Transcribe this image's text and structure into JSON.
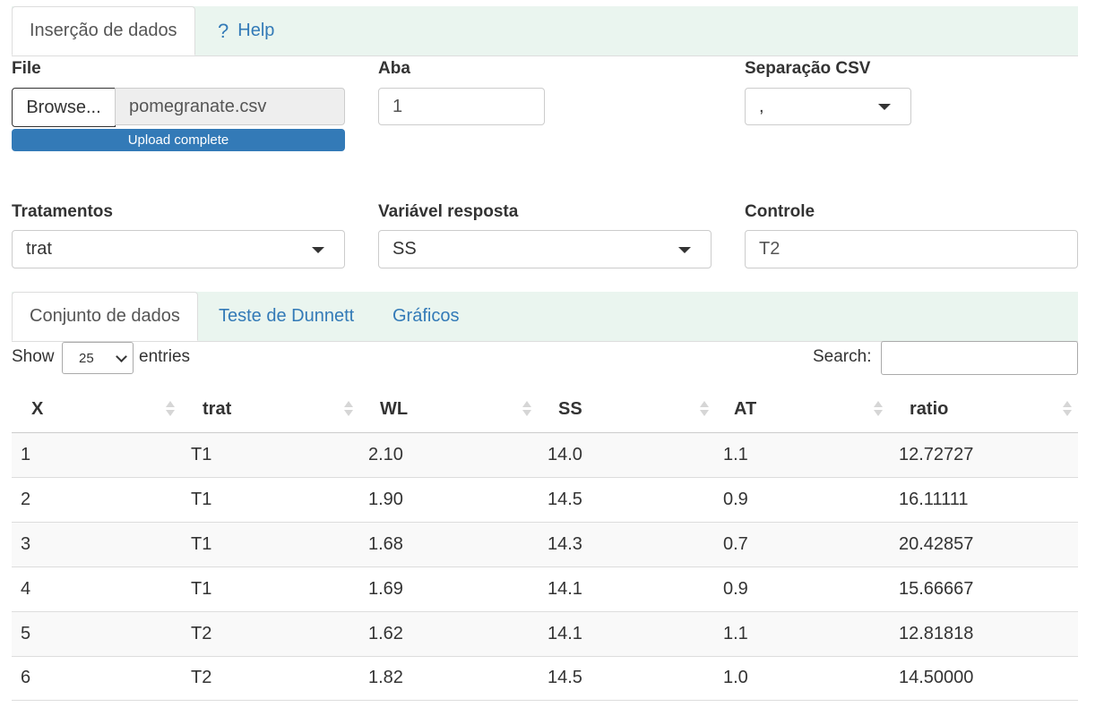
{
  "tabs_top": [
    {
      "label": "Inserção de dados"
    },
    {
      "label": "Help"
    }
  ],
  "file": {
    "label": "File",
    "browse_label": "Browse...",
    "filename": "pomegranate.csv",
    "progress_text": "Upload complete",
    "progress_fraction": 1.0
  },
  "aba": {
    "label": "Aba",
    "value": "1"
  },
  "separacao": {
    "label": "Separação CSV",
    "value": ","
  },
  "tratamentos": {
    "label": "Tratamentos",
    "value": "trat"
  },
  "variavel": {
    "label": "Variável resposta",
    "value": "SS"
  },
  "controle": {
    "label": "Controle",
    "value": "T2"
  },
  "tabs_bottom": [
    {
      "label": "Conjunto de dados"
    },
    {
      "label": "Teste de Dunnett"
    },
    {
      "label": "Gráficos"
    }
  ],
  "table_controls": {
    "show_label": "Show",
    "entries_value": "25",
    "entries_label": "entries",
    "search_label": "Search:"
  },
  "table": {
    "columns": [
      "X",
      "trat",
      "WL",
      "SS",
      "AT",
      "ratio"
    ],
    "rows": [
      [
        "1",
        "T1",
        "2.10",
        "14.0",
        "1.1",
        "12.72727"
      ],
      [
        "2",
        "T1",
        "1.90",
        "14.5",
        "0.9",
        "16.11111"
      ],
      [
        "3",
        "T1",
        "1.68",
        "14.3",
        "0.7",
        "20.42857"
      ],
      [
        "4",
        "T1",
        "1.69",
        "14.1",
        "0.9",
        "15.66667"
      ],
      [
        "5",
        "T2",
        "1.62",
        "14.1",
        "1.1",
        "12.81818"
      ],
      [
        "6",
        "T2",
        "1.82",
        "14.5",
        "1.0",
        "14.50000"
      ]
    ]
  },
  "colors": {
    "accent": "#337ab7",
    "tabbar_bg": "#eaf5ef"
  }
}
